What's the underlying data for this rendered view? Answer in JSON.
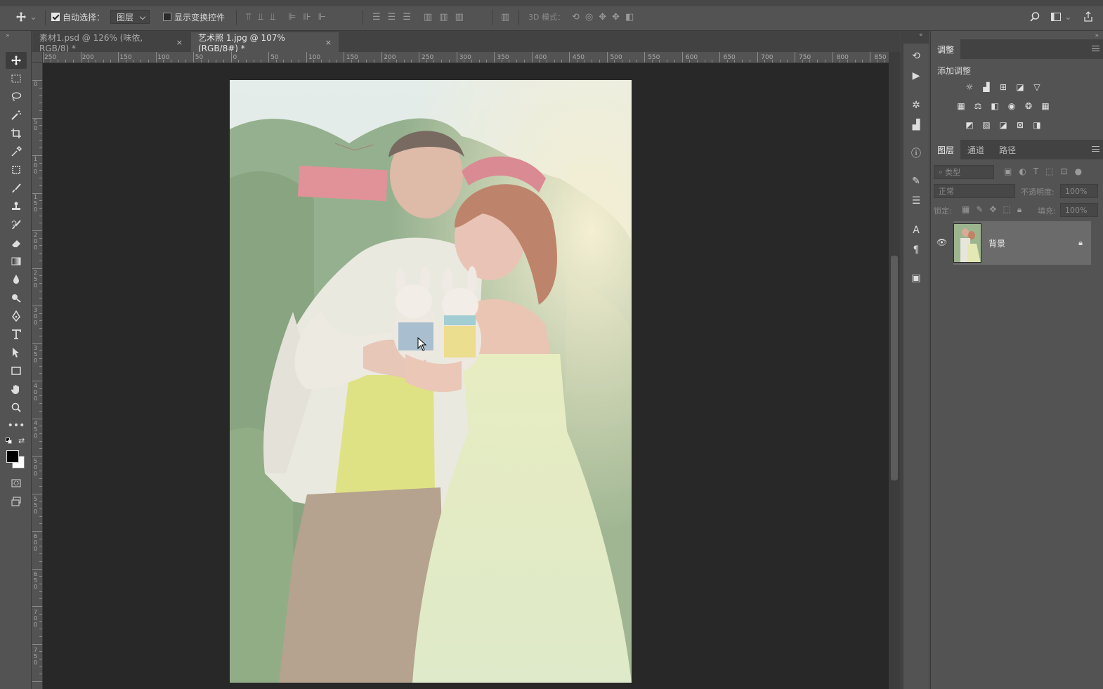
{
  "options_bar": {
    "auto_select_label": "自动选择：",
    "auto_select_value": "图层",
    "show_transform_label": "显示变换控件",
    "mode_3d_label": "3D 模式："
  },
  "tabs": [
    {
      "label": "素材1.psd @ 126% (味依, RGB/8) *",
      "close": "×"
    },
    {
      "label": "艺术照 1.jpg @ 107%(RGB/8#) *",
      "close": "×"
    }
  ],
  "ruler": {
    "h_ticks": [
      "250",
      "200",
      "150",
      "100",
      "50",
      "0",
      "50",
      "100",
      "150",
      "200",
      "250",
      "300",
      "350",
      "400",
      "450",
      "500",
      "550",
      "600",
      "650",
      "700",
      "750",
      "800",
      "850"
    ],
    "v_ticks": [
      "0",
      "50",
      "100",
      "150",
      "200",
      "250",
      "300",
      "350",
      "400",
      "450",
      "500",
      "550",
      "600",
      "650",
      "700",
      "750"
    ]
  },
  "adjustments": {
    "tab": "调整",
    "add_label": "添加调整"
  },
  "layers": {
    "tabs": [
      "图层",
      "通道",
      "路径"
    ],
    "filter_placeholder": "类型",
    "blend_mode": "正常",
    "opacity_label": "不透明度:",
    "opacity_value": "100%",
    "lock_label": "锁定:",
    "fill_label": "填充:",
    "fill_value": "100%",
    "layer_name": "背景"
  }
}
